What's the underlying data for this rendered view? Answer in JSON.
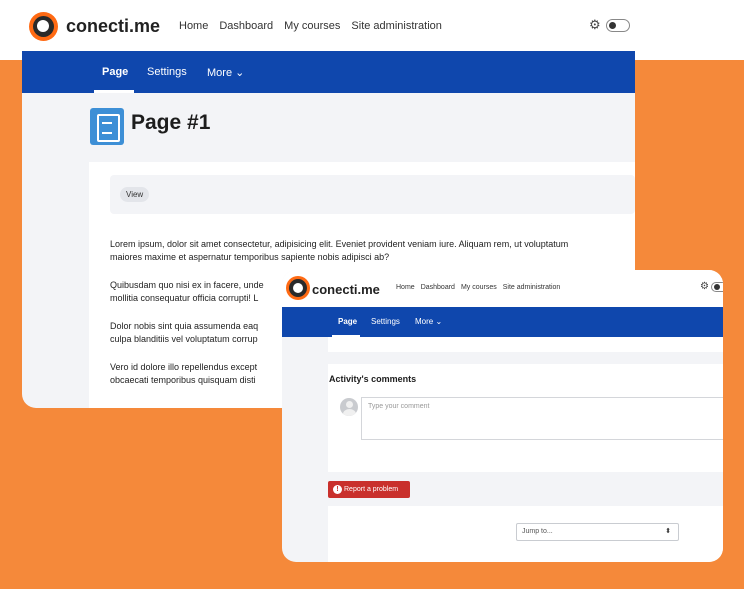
{
  "site": {
    "name": "conecti.me",
    "nav": [
      "Home",
      "Dashboard",
      "My courses",
      "Site administration"
    ],
    "gear_icon": "gear-icon"
  },
  "secondary_nav": {
    "page": "Page",
    "settings": "Settings",
    "more": "More ⌄"
  },
  "page": {
    "title": "Page #1",
    "view_label": "View",
    "paragraphs": [
      "Lorem ipsum, dolor sit amet consectetur, adipisicing elit. Eveniet provident veniam iure. Aliquam rem, ut voluptatum",
      "maiores maxime et aspernatur temporibus sapiente nobis adipisci ab?",
      "Quibusdam quo nisi ex in facere, unde",
      "mollitia consequatur officia corrupti! L",
      "Dolor nobis sint quia assumenda eaq",
      "culpa blanditiis vel voluptatum corrup",
      "Vero id dolore illo repellendus except",
      "obcaecati temporibus quisquam disti"
    ]
  },
  "comments": {
    "title": "Activity's comments",
    "placeholder": "Type your comment"
  },
  "report_problem": "Report a problem",
  "jump_to": {
    "value": "Jump to...",
    "arrow": "⬍"
  },
  "colors": {
    "orange": "#f5893a",
    "nav_blue": "#0f47ad",
    "report_red": "#c9302c",
    "logo_orange": "#ff6a13"
  }
}
